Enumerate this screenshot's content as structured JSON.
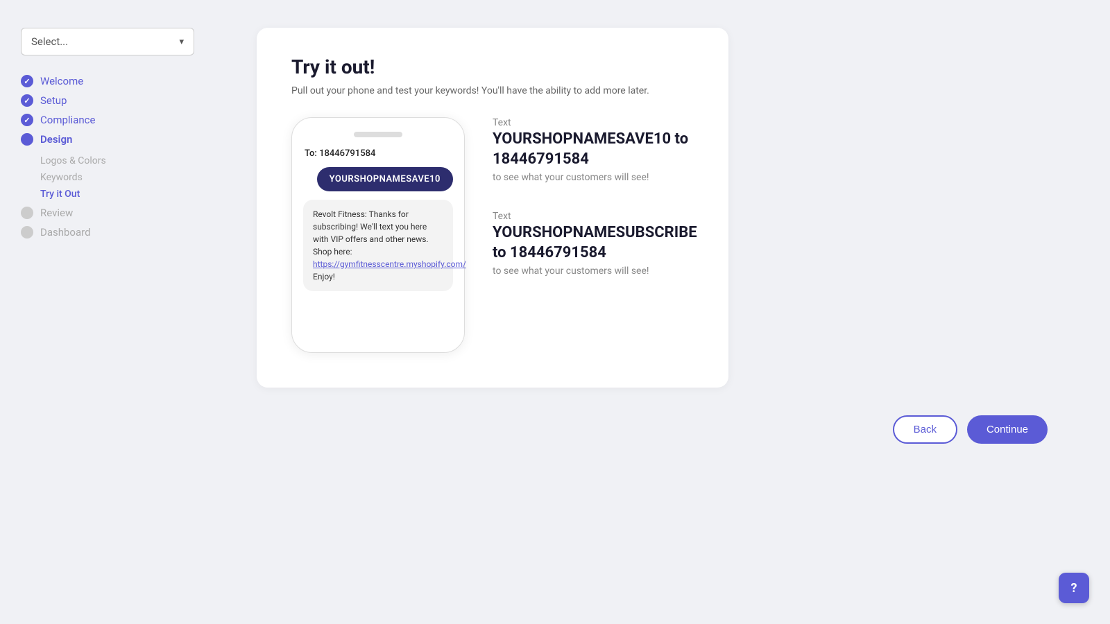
{
  "sidebar": {
    "select": {
      "placeholder": "Select...",
      "arrow": "▾"
    },
    "nav_items": [
      {
        "id": "welcome",
        "label": "Welcome",
        "state": "completed"
      },
      {
        "id": "setup",
        "label": "Setup",
        "state": "completed"
      },
      {
        "id": "compliance",
        "label": "Compliance",
        "state": "completed"
      },
      {
        "id": "design",
        "label": "Design",
        "state": "active",
        "sub_items": [
          {
            "id": "logos-colors",
            "label": "Logos & Colors",
            "state": "inactive"
          },
          {
            "id": "keywords",
            "label": "Keywords",
            "state": "inactive"
          },
          {
            "id": "try-it-out",
            "label": "Try it Out",
            "state": "active"
          }
        ]
      },
      {
        "id": "review",
        "label": "Review",
        "state": "inactive"
      },
      {
        "id": "dashboard",
        "label": "Dashboard",
        "state": "inactive"
      }
    ]
  },
  "page": {
    "title": "Try it out!",
    "subtitle": "Pull out your phone and test your keywords! You'll have the ability to add more later."
  },
  "phone": {
    "to_label": "To:",
    "to_number": "18446791584",
    "keyword_bubble": "YOURSHOPNAMESAVE10",
    "reply_text": "Revolt Fitness: Thanks for subscribing! We'll text you here with VIP offers and other news. Shop here: ",
    "reply_link": "https://gymfitnesscentre.myshopify.com/",
    "reply_suffix": " Enjoy!"
  },
  "text_blocks": [
    {
      "id": "save10",
      "prefix": "Text",
      "keyword": "YOURSHOPNAMESAVE10 to 18446791584",
      "suffix": "to see what your customers will see!"
    },
    {
      "id": "subscribe",
      "prefix": "Text",
      "keyword": "YOURSHOPNAMESUBSCRIBE to 18446791584",
      "suffix": "to see what your customers will see!"
    }
  ],
  "buttons": {
    "back": "Back",
    "continue": "Continue"
  },
  "help": {
    "icon": "?"
  }
}
